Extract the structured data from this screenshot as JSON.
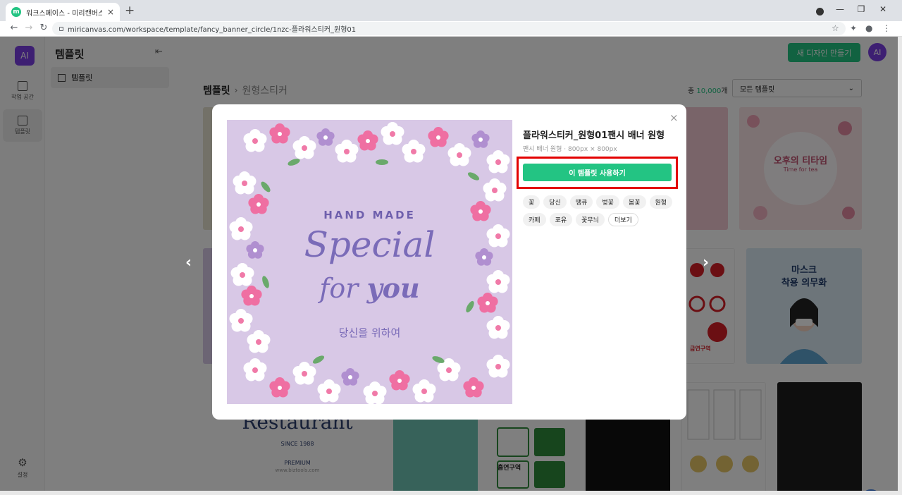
{
  "browser": {
    "tab_title": "워크스페이스 - 미리캔버스",
    "tab_close": "×",
    "new_tab": "+",
    "url": "miricanvas.com/workspace/template/fancy_banner_circle/1nzc-플라워스티커_원형01",
    "minimize": "—",
    "restore": "❐",
    "close": "✕"
  },
  "app": {
    "logo": "AI",
    "rail": {
      "workspace_label": "작업 공간",
      "templates_label": "템플릿",
      "settings_label": "설정"
    },
    "panel": {
      "title": "템플릿",
      "item_label": "템플릿"
    },
    "header": {
      "new_design_label": "새 디자인 만들기",
      "avatar_initials": "AI"
    },
    "breadcrumb": {
      "root": "템플릿",
      "separator": "›",
      "current": "원형스티커"
    },
    "total": {
      "prefix": "총 ",
      "count": "10,000",
      "suffix": "개"
    },
    "filter": {
      "selected": "모든 템플릿"
    },
    "cards": {
      "tea_title": "오후의 티타임",
      "tea_sub": "Time for tea",
      "mask_title_1": "마스크",
      "mask_title_2": "착용 의무화",
      "no_smoking": "금연구역",
      "restaurant_title": "Restaurant",
      "restaurant_since": "SINCE 1988",
      "restaurant_premium": "PREMIUM",
      "restaurant_url": "www.biztools.com",
      "no_smoking_2": "흡연구역"
    }
  },
  "modal": {
    "title": "플라워스티커_원형01팬시 배너 원형",
    "subtitle": "팬시 배너 원형 · 800px × 800px",
    "use_button": "이 템플릿 사용하기",
    "close": "×",
    "tags": [
      "꽃",
      "당신",
      "땡큐",
      "벚꽃",
      "봄꽃",
      "원형",
      "카페",
      "포유",
      "꽃무늬",
      "더보기"
    ],
    "preview": {
      "top_text": "HAND MADE",
      "script_1": "Special",
      "script_2": "for",
      "script_3": "you",
      "korean": "당신을 위하여"
    },
    "prev_arrow": "‹",
    "next_arrow": "›"
  },
  "colors": {
    "brand_green": "#23c483",
    "brand_purple": "#7b3fe4",
    "highlight_red": "#e30000",
    "preview_bg": "#d8c8e6",
    "script_purple": "#7a6bb8"
  }
}
